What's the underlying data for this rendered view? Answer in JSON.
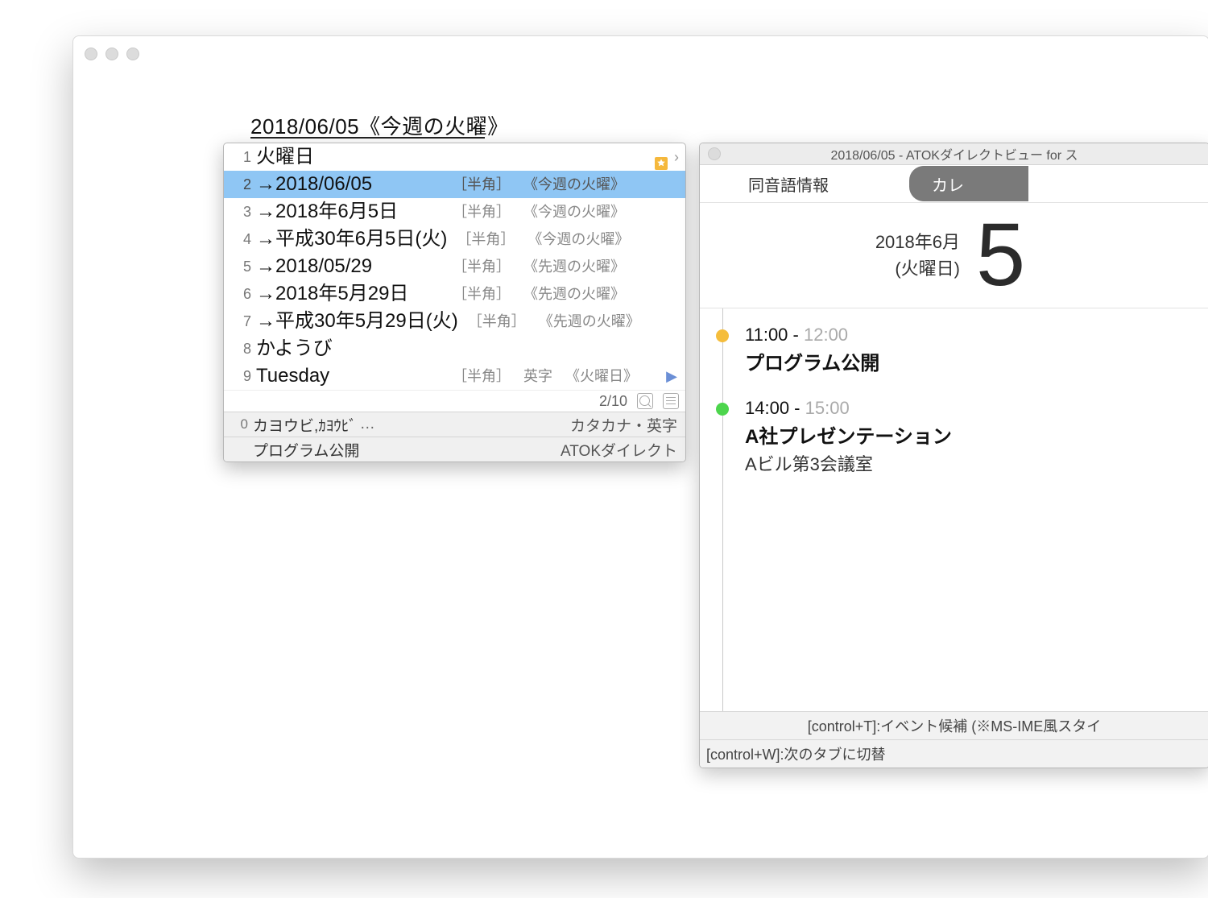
{
  "input_text": "2018/06/05《今週の火曜》",
  "candidates": [
    {
      "n": "1",
      "text": "火曜日",
      "tag_hw": "",
      "tag_alpha": "",
      "tag_note": "",
      "star": true,
      "chev": true,
      "row_chev": false,
      "selected": false
    },
    {
      "n": "2",
      "text": "→2018/06/05",
      "tag_hw": "［半角］",
      "tag_alpha": "",
      "tag_note": "《今週の火曜》",
      "star": false,
      "chev": false,
      "row_chev": false,
      "selected": true
    },
    {
      "n": "3",
      "text": "→2018年6月5日",
      "tag_hw": "［半角］",
      "tag_alpha": "",
      "tag_note": "《今週の火曜》",
      "star": false,
      "chev": false,
      "row_chev": false,
      "selected": false
    },
    {
      "n": "4",
      "text": "→平成30年6月5日(火)",
      "tag_hw": "［半角］",
      "tag_alpha": "",
      "tag_note": "《今週の火曜》",
      "star": false,
      "chev": false,
      "row_chev": false,
      "selected": false
    },
    {
      "n": "5",
      "text": "→2018/05/29",
      "tag_hw": "［半角］",
      "tag_alpha": "",
      "tag_note": "《先週の火曜》",
      "star": false,
      "chev": false,
      "row_chev": false,
      "selected": false
    },
    {
      "n": "6",
      "text": "→2018年5月29日",
      "tag_hw": "［半角］",
      "tag_alpha": "",
      "tag_note": "《先週の火曜》",
      "star": false,
      "chev": false,
      "row_chev": false,
      "selected": false
    },
    {
      "n": "7",
      "text": "→平成30年5月29日(火)",
      "tag_hw": "［半角］",
      "tag_alpha": "",
      "tag_note": "《先週の火曜》",
      "star": false,
      "chev": false,
      "row_chev": false,
      "selected": false
    },
    {
      "n": "8",
      "text": "かようび",
      "tag_hw": "",
      "tag_alpha": "",
      "tag_note": "",
      "star": false,
      "chev": false,
      "row_chev": false,
      "selected": false
    },
    {
      "n": "9",
      "text": "Tuesday",
      "tag_hw": "［半角］",
      "tag_alpha": "英字",
      "tag_note": "《火曜日》",
      "star": false,
      "chev": false,
      "row_chev": true,
      "selected": false
    }
  ],
  "status": {
    "count": "2/10"
  },
  "sub_rows": [
    {
      "n": "0",
      "label": "カヨウビ,ｶﾖｳﾋﾞ",
      "ellipsis": "…",
      "right": "カタカナ・英字"
    },
    {
      "n": "",
      "label": "プログラム公開",
      "ellipsis": "",
      "right": "ATOKダイレクト"
    }
  ],
  "direct_view": {
    "title": "2018/06/05 - ATOKダイレクトビュー for ス",
    "tab_a": "同音語情報",
    "tab_b": "カレ",
    "date_line1": "2018年6月",
    "date_line2": "(火曜日)",
    "big_day": "5",
    "events": [
      {
        "dot": "dot-orange",
        "t1": "11:00",
        "sep": " - ",
        "t2": "12:00",
        "title": "プログラム公開",
        "loc": ""
      },
      {
        "dot": "dot-green",
        "t1": "14:00",
        "sep": " - ",
        "t2": "15:00",
        "title": "A社プレゼンテーション",
        "loc": "Aビル第3会議室"
      }
    ],
    "footer1": "[control+T]:イベント候補 (※MS-IME風スタイ",
    "footer2": "[control+W]:次のタブに切替"
  }
}
